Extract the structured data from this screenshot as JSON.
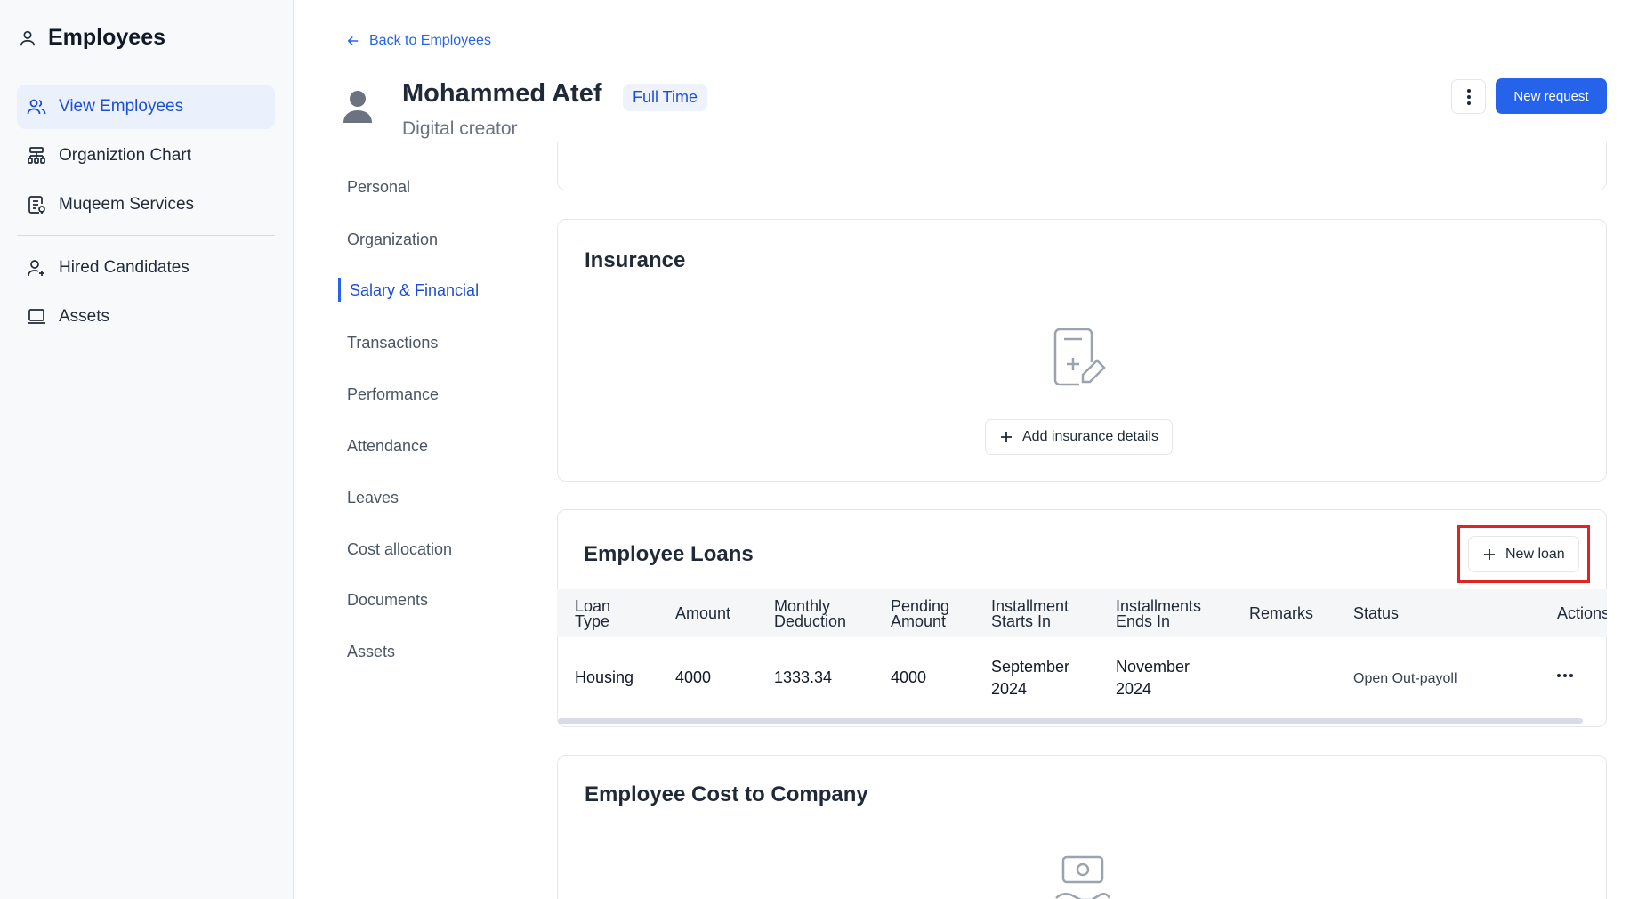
{
  "sidebar": {
    "title": "Employees",
    "items": [
      {
        "label": "View Employees",
        "icon": "users-icon",
        "active": true
      },
      {
        "label": "Organiztion Chart",
        "icon": "org-chart-icon"
      },
      {
        "label": "Muqeem Services",
        "icon": "document-services-icon"
      },
      {
        "label": "Hired Candidates",
        "icon": "user-add-icon"
      },
      {
        "label": "Assets",
        "icon": "laptop-icon"
      }
    ]
  },
  "header": {
    "back_label": "Back to Employees",
    "employee_name": "Mohammed Atef",
    "employment_type": "Full Time",
    "role": "Digital creator",
    "new_request_label": "New request"
  },
  "section_nav": {
    "items": [
      "Personal",
      "Organization",
      "Salary & Financial",
      "Transactions",
      "Performance",
      "Attendance",
      "Leaves",
      "Cost allocation",
      "Documents",
      "Assets"
    ],
    "active": "Salary & Financial"
  },
  "insurance": {
    "title": "Insurance",
    "add_label": "Add insurance details"
  },
  "loans": {
    "title": "Employee Loans",
    "new_loan_label": "New loan",
    "columns": [
      [
        "Loan",
        "Type"
      ],
      [
        "Amount"
      ],
      [
        "Monthly",
        "Deduction"
      ],
      [
        "Pending",
        "Amount"
      ],
      [
        "Installment",
        "Starts In"
      ],
      [
        "Installments",
        "Ends In"
      ],
      [
        "Remarks"
      ],
      [
        "Status"
      ],
      [
        "Actions"
      ]
    ],
    "rows": [
      {
        "type": "Housing",
        "amount": "4000",
        "monthly_deduction": "1333.34",
        "pending_amount": "4000",
        "starts_in": [
          "September",
          "2024"
        ],
        "ends_in": [
          "November",
          "2024"
        ],
        "remarks": "",
        "status": "Open Out-payoll"
      }
    ]
  },
  "cost_to_company": {
    "title": "Employee Cost to Company"
  },
  "colors": {
    "accent": "#2563eb",
    "highlight": "#e02424",
    "sidebar_bg": "#f8f9fb"
  }
}
